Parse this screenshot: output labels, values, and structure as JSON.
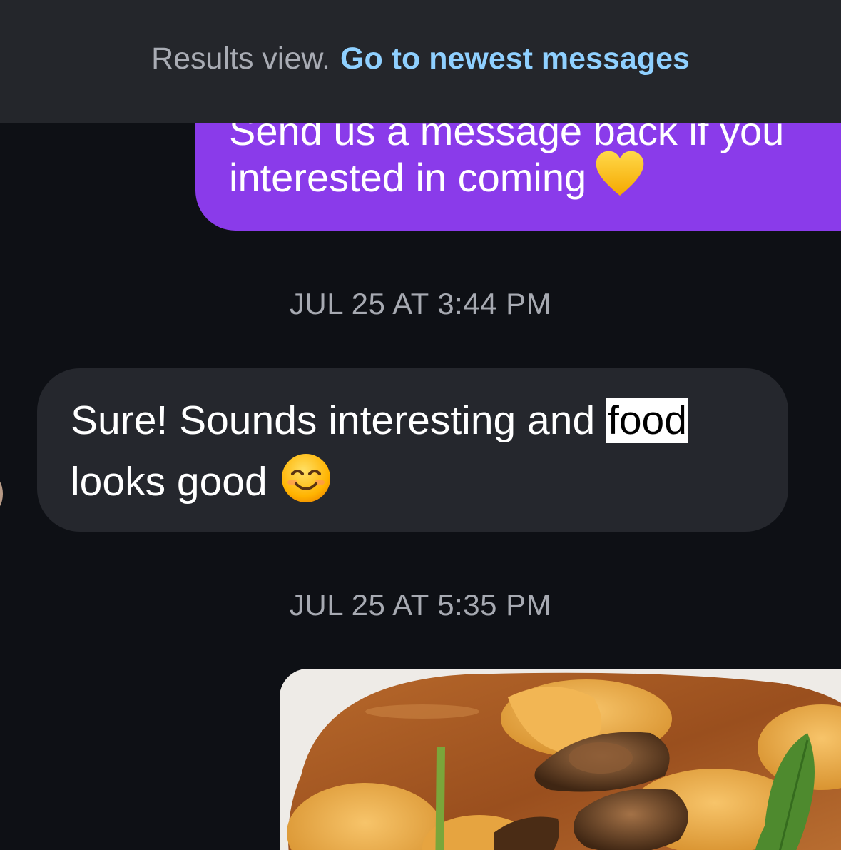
{
  "banner": {
    "status_text": "Results view.",
    "link_label": "Go to newest messages"
  },
  "messages": [
    {
      "direction": "outgoing",
      "partial_line": "Send us a message back if you",
      "line": "interested in coming",
      "emoji_icon": "yellow-heart-icon"
    },
    {
      "timestamp": "JUL 25 AT 3:44 PM"
    },
    {
      "direction": "incoming",
      "line1_before": "Sure! Sounds interesting and ",
      "highlighted_word": "food",
      "line2": "looks good",
      "emoji_icon": "smiling-face-icon"
    },
    {
      "timestamp": "JUL 25 AT 5:35 PM"
    },
    {
      "direction": "outgoing",
      "type": "photo",
      "image_icon": "food-photo-tortellini-mushrooms"
    }
  ],
  "colors": {
    "outgoing_bubble": "#8a3bea",
    "incoming_bubble": "#25272d",
    "banner_bg": "#24262b",
    "link": "#8fd0ff",
    "background": "#0e1015"
  }
}
